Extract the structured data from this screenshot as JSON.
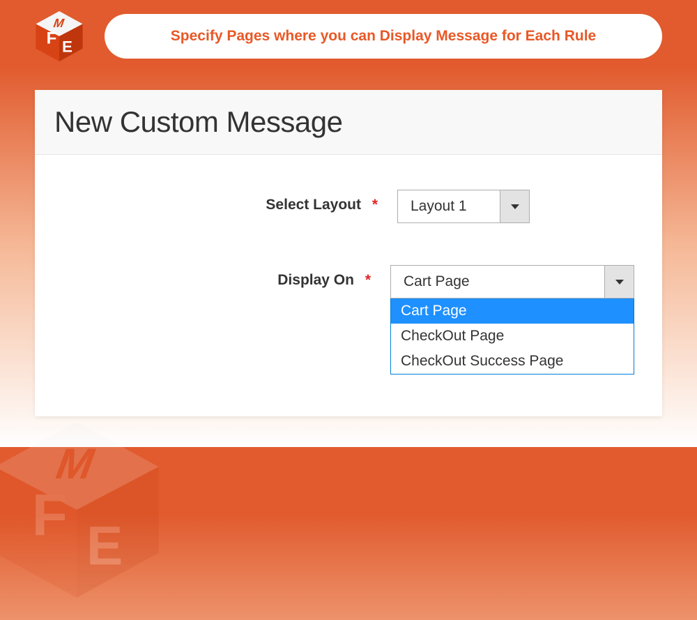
{
  "banner": {
    "title": "Specify Pages where you can Display Message for Each Rule"
  },
  "panel": {
    "title": "New Custom Message"
  },
  "form": {
    "select_layout": {
      "label": "Select Layout",
      "required_marker": "*",
      "value": "Layout 1"
    },
    "display_on": {
      "label": "Display On",
      "required_marker": "*",
      "value": "Cart Page",
      "options": [
        {
          "label": "Cart Page",
          "selected": true
        },
        {
          "label": "CheckOut Page",
          "selected": false
        },
        {
          "label": "CheckOut Success Page",
          "selected": false
        }
      ]
    }
  },
  "colors": {
    "accent": "#e85826",
    "selection": "#1e90ff"
  }
}
